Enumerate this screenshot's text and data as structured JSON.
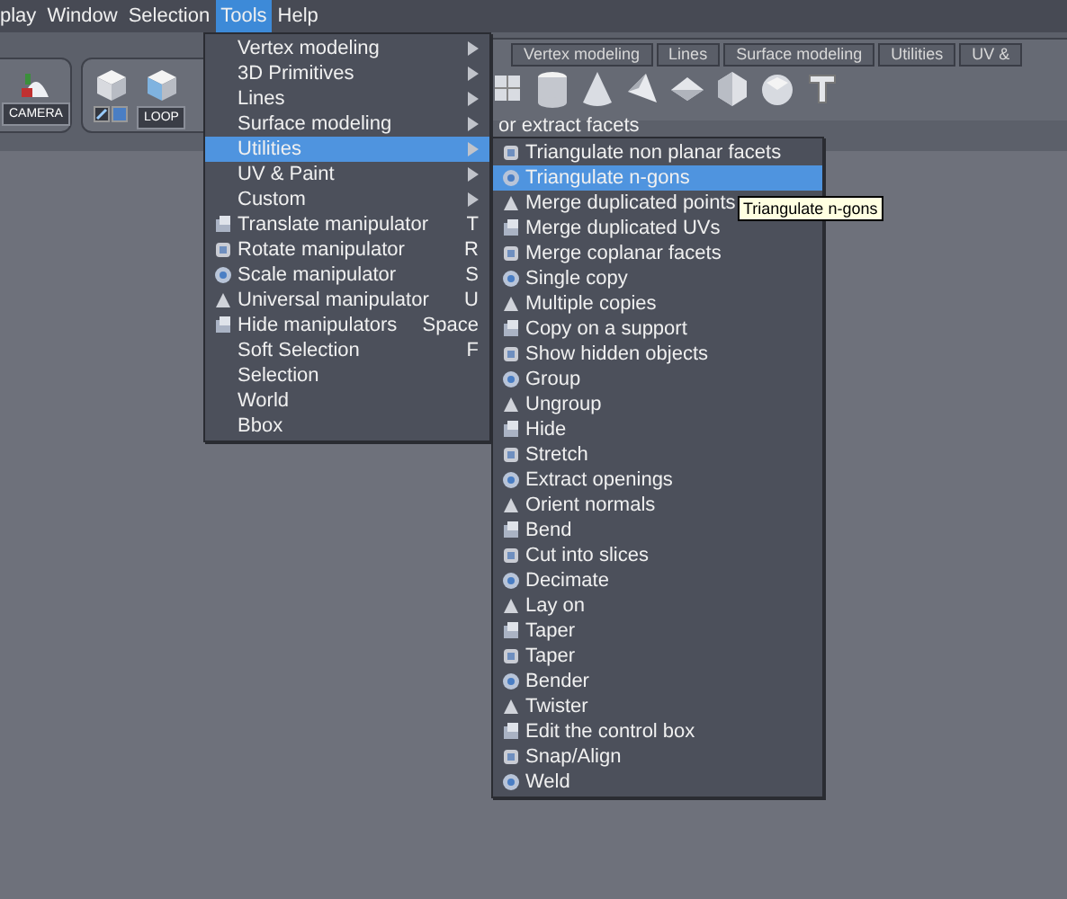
{
  "menubar": [
    {
      "label": "play",
      "selected": false
    },
    {
      "label": "Window",
      "selected": false
    },
    {
      "label": "Selection",
      "selected": false
    },
    {
      "label": "Tools",
      "selected": true
    },
    {
      "label": "Help",
      "selected": false
    }
  ],
  "toolbar": {
    "camera_button": "CAMERA",
    "loop_button": "LOOP",
    "tabs": [
      {
        "label": "Vertex modeling"
      },
      {
        "label": "Lines"
      },
      {
        "label": "Surface modeling"
      },
      {
        "label": "Utilities"
      },
      {
        "label": "UV &"
      }
    ],
    "hint": "or extract facets"
  },
  "tools_menu": [
    {
      "label": "Vertex modeling",
      "kind": "submenu",
      "selected": false
    },
    {
      "label": "3D Primitives",
      "kind": "submenu",
      "selected": false
    },
    {
      "label": "Lines",
      "kind": "submenu",
      "selected": false
    },
    {
      "label": "Surface modeling",
      "kind": "submenu",
      "selected": false
    },
    {
      "label": "Utilities",
      "kind": "submenu",
      "selected": true
    },
    {
      "label": "UV & Paint",
      "kind": "submenu",
      "selected": false
    },
    {
      "label": "Custom",
      "kind": "submenu",
      "selected": false
    },
    {
      "label": "Translate manipulator",
      "kind": "tool",
      "shortcut": "T",
      "selected": false
    },
    {
      "label": "Rotate manipulator",
      "kind": "tool",
      "shortcut": "R",
      "selected": false
    },
    {
      "label": "Scale manipulator",
      "kind": "tool",
      "shortcut": "S",
      "selected": false
    },
    {
      "label": "Universal manipulator",
      "kind": "tool",
      "shortcut": "U",
      "selected": false
    },
    {
      "label": "Hide manipulators",
      "kind": "tool",
      "shortcut": "Space",
      "selected": false
    },
    {
      "label": "Soft Selection",
      "kind": "plain",
      "shortcut": "F",
      "selected": false
    },
    {
      "label": "Selection",
      "kind": "plain",
      "selected": false
    },
    {
      "label": "World",
      "kind": "plain",
      "selected": false
    },
    {
      "label": "Bbox",
      "kind": "plain",
      "selected": false
    }
  ],
  "utilities_menu": [
    {
      "label": "Triangulate non planar facets",
      "kind": "tool",
      "selected": false
    },
    {
      "label": "Triangulate n-gons",
      "kind": "tool",
      "selected": true
    },
    {
      "label": "Merge duplicated points",
      "kind": "tool",
      "selected": false
    },
    {
      "label": "Merge duplicated UVs",
      "kind": "tool",
      "selected": false
    },
    {
      "label": "Merge coplanar facets",
      "kind": "tool",
      "selected": false
    },
    {
      "label": "Single copy",
      "kind": "tool",
      "selected": false
    },
    {
      "label": "Multiple copies",
      "kind": "tool",
      "selected": false
    },
    {
      "label": "Copy on a support",
      "kind": "tool",
      "selected": false
    },
    {
      "label": "Show hidden objects",
      "kind": "tool",
      "selected": false
    },
    {
      "label": "Group",
      "kind": "tool",
      "selected": false
    },
    {
      "label": "Ungroup",
      "kind": "tool",
      "selected": false
    },
    {
      "label": "Hide",
      "kind": "tool",
      "selected": false
    },
    {
      "label": "Stretch",
      "kind": "tool",
      "selected": false
    },
    {
      "label": "Extract openings",
      "kind": "tool",
      "selected": false
    },
    {
      "label": "Orient normals",
      "kind": "tool",
      "selected": false
    },
    {
      "label": "Bend",
      "kind": "tool",
      "selected": false
    },
    {
      "label": "Cut into slices",
      "kind": "tool",
      "selected": false
    },
    {
      "label": "Decimate",
      "kind": "tool",
      "selected": false
    },
    {
      "label": "Lay on",
      "kind": "tool",
      "selected": false
    },
    {
      "label": "Taper",
      "kind": "tool",
      "selected": false
    },
    {
      "label": "Taper",
      "kind": "tool",
      "selected": false
    },
    {
      "label": "Bender",
      "kind": "tool",
      "selected": false
    },
    {
      "label": "Twister",
      "kind": "tool",
      "selected": false
    },
    {
      "label": "Edit the control box",
      "kind": "tool",
      "selected": false
    },
    {
      "label": "Snap/Align",
      "kind": "tool",
      "selected": false
    },
    {
      "label": "Weld",
      "kind": "tool",
      "selected": false
    }
  ],
  "tooltip": "Triangulate n-gons"
}
